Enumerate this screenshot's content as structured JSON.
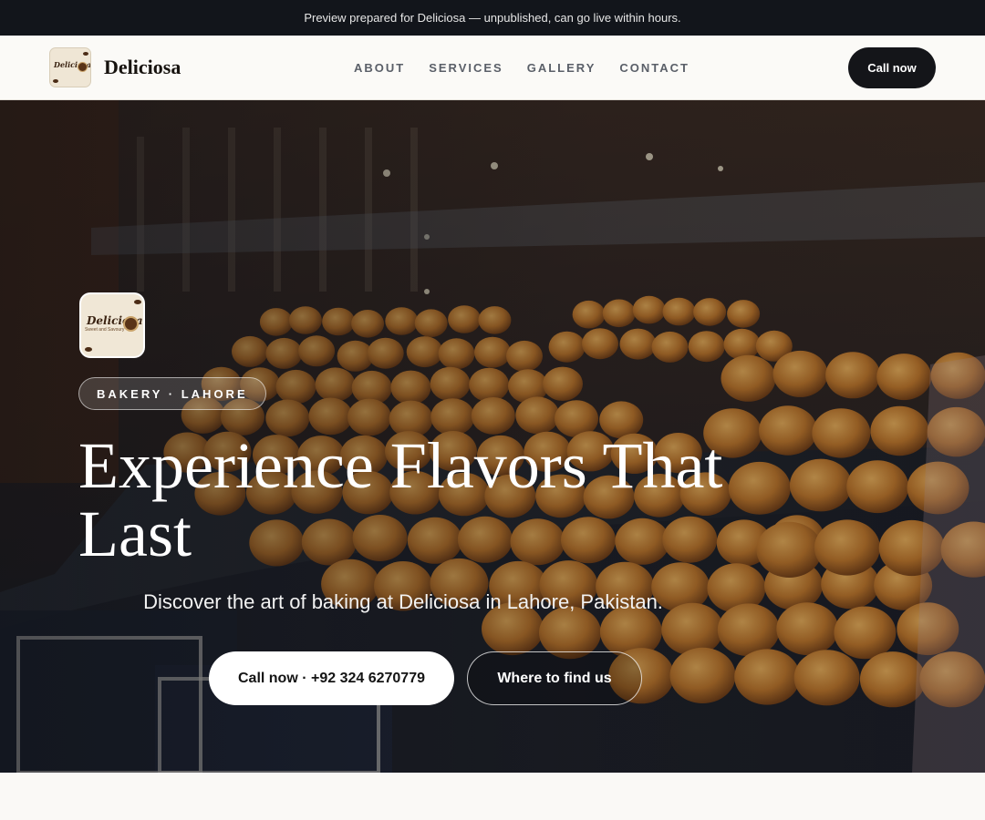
{
  "banner": {
    "text": "Preview prepared for Deliciosa — unpublished, can go live within hours."
  },
  "header": {
    "brand_name": "Deliciosa",
    "logo_text": "Deliciosa",
    "nav": [
      "ABOUT",
      "SERVICES",
      "GALLERY",
      "CONTACT"
    ],
    "cta_label": "Call now"
  },
  "hero": {
    "logo_text": "Deliciosa",
    "logo_subtext": "Sweet and Savoury",
    "tag": "BAKERY · LAHORE",
    "headline": "Experience Flavors That Last",
    "subheadline": "Discover the art of baking at Deliciosa in Lahore, Pakistan.",
    "primary_button": "Call now · +92 324 6270779",
    "secondary_button": "Where to find us",
    "background": "photo of bakery display case stacked with golden baked buns"
  },
  "colors": {
    "topbar_bg": "#12151b",
    "nav_bg": "#fbfaf7",
    "cta_bg": "#141519",
    "bun": "#c9852f",
    "page_bg": "#faf9f6"
  }
}
